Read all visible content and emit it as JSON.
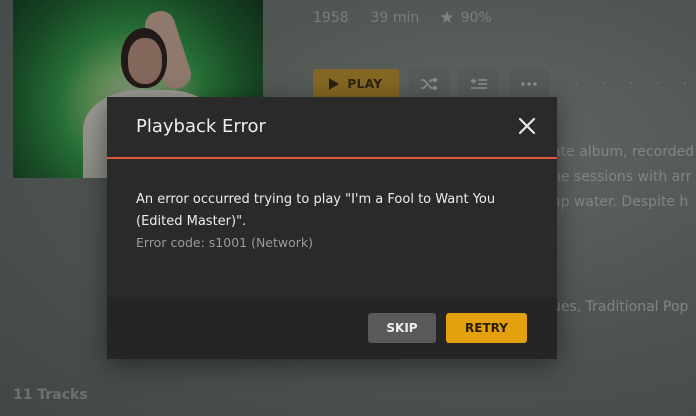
{
  "album": {
    "year": "1958",
    "duration": "39 min",
    "rating": "90%",
    "icons": {
      "rating": "star-icon"
    }
  },
  "actions": {
    "play_label": "PLAY",
    "shuffle_icon": "shuffle-icon",
    "queue_icon": "add-to-queue-icon",
    "more_icon": "more-icon",
    "trail": "· · · · ·"
  },
  "description": {
    "line1": "ate album, recorded",
    "line2": "he sessions with arr",
    "line3": "ap water. Despite h",
    "genres": "ues, Traditional Pop"
  },
  "tracks_label": "11 Tracks",
  "dialog": {
    "title": "Playback Error",
    "message": "An error occurred trying to play \"I'm a Fool to Want You (Edited Master)\".",
    "error_code": "Error code: s1001 (Network)",
    "skip_label": "SKIP",
    "retry_label": "RETRY",
    "accent_color": "#e5553b",
    "retry_color": "#e5a00d"
  }
}
